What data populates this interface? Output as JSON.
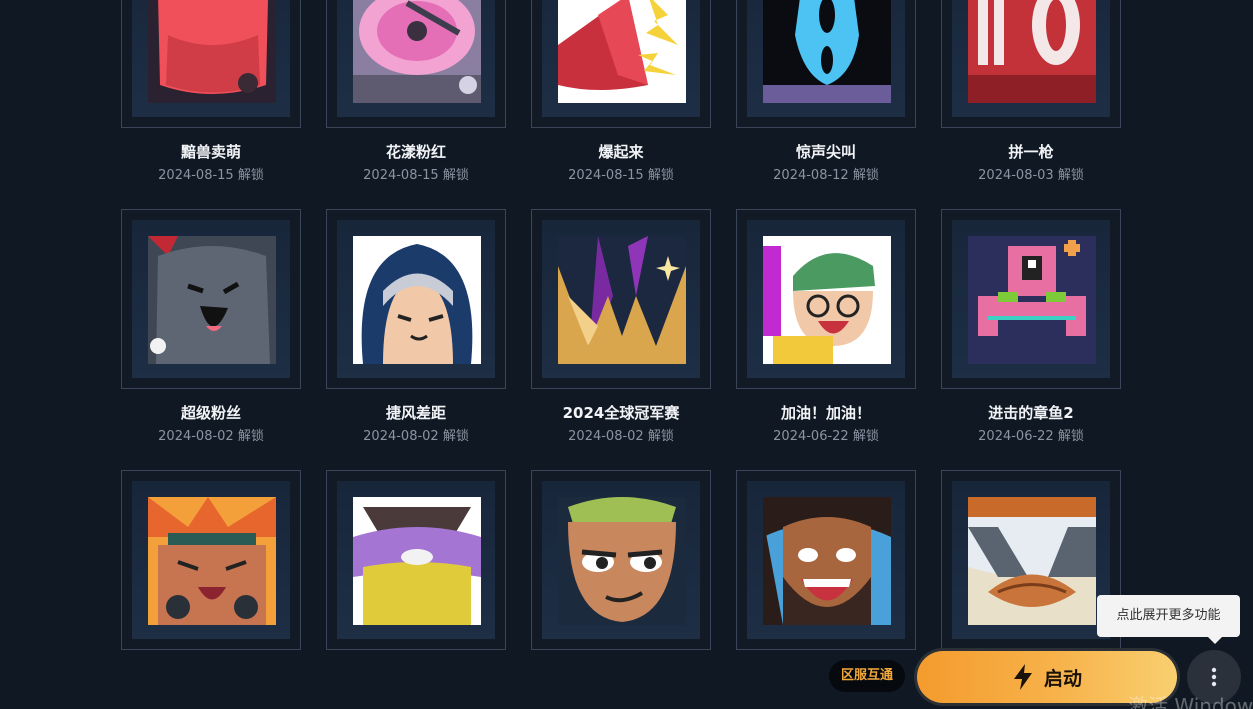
{
  "sprays": [
    {
      "name": "黯兽卖萌",
      "date": "2024-08-15 解锁",
      "art": "red-blob"
    },
    {
      "name": "花漾粉红",
      "date": "2024-08-15 解锁",
      "art": "pink-turntable"
    },
    {
      "name": "爆起来",
      "date": "2024-08-15 解锁",
      "art": "red-horn"
    },
    {
      "name": "惊声尖叫",
      "date": "2024-08-12 解锁",
      "art": "blue-scream"
    },
    {
      "name": "拼一枪",
      "date": "2024-08-03 解锁",
      "art": "red-ammo"
    },
    {
      "name": "超级粉丝",
      "date": "2024-08-02 解锁",
      "art": "grey-creature"
    },
    {
      "name": "捷风差距",
      "date": "2024-08-02 解锁",
      "art": "blue-hood-agent"
    },
    {
      "name": "2024全球冠军赛",
      "date": "2024-08-02 解锁",
      "art": "gold-crown"
    },
    {
      "name": "加油！加油！",
      "date": "2024-06-22 解锁",
      "art": "green-beanie-agent"
    },
    {
      "name": "进击的章鱼2",
      "date": "2024-06-22 解锁",
      "art": "pixel-octopus"
    },
    {
      "name": "",
      "date": "",
      "art": "laughing-agent"
    },
    {
      "name": "",
      "date": "",
      "art": "purple-bird"
    },
    {
      "name": "",
      "date": "",
      "art": "smug-face"
    },
    {
      "name": "",
      "date": "",
      "art": "bearded-laugh"
    },
    {
      "name": "",
      "date": "",
      "art": "duck-visor"
    }
  ],
  "tooltip": {
    "text": "点此展开更多功能"
  },
  "region_badge": {
    "label": "区服互通"
  },
  "launch": {
    "label": "启动",
    "icon": "lightning-bolt-icon"
  },
  "more": {
    "icon": "vertical-ellipsis-icon"
  },
  "watermark": {
    "text": "激活 Windows"
  },
  "colors": {
    "accent": "#f7b34b",
    "background": "#101923"
  }
}
